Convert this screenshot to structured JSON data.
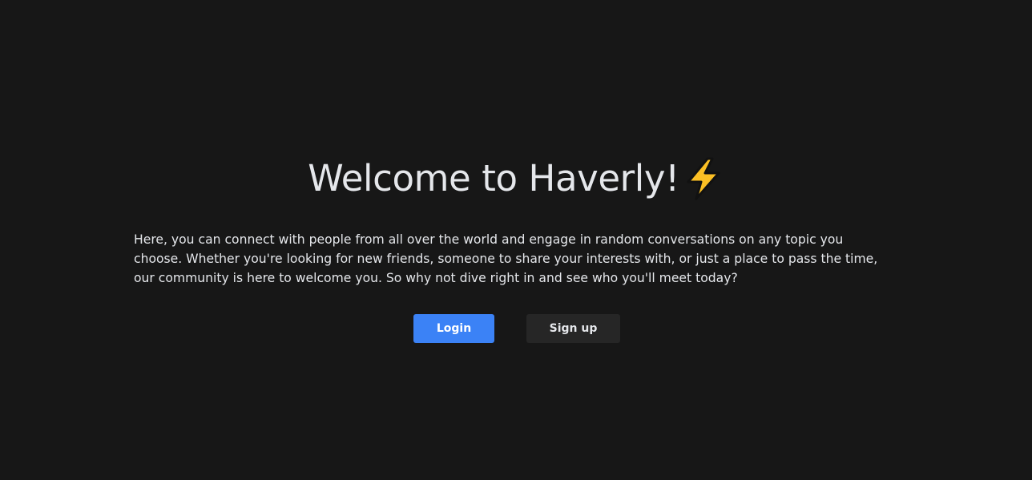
{
  "hero": {
    "title": "Welcome to Haverly!",
    "title_icon": "lightning-bolt-emoji",
    "description": "Here, you can connect with people from all over the world and engage in random conversations on any topic you choose. Whether you're looking for new friends, someone to share your interests with, or just a place to pass the time, our community is here to welcome you. So why not dive right in and see who you'll meet today?"
  },
  "actions": {
    "login_label": "Login",
    "signup_label": "Sign up"
  },
  "colors": {
    "background": "#171717",
    "text": "#e5e7eb",
    "primary": "#3b82f6",
    "secondary": "#262626",
    "bolt_fill": "#fbbf24",
    "bolt_stroke": "#111111"
  }
}
